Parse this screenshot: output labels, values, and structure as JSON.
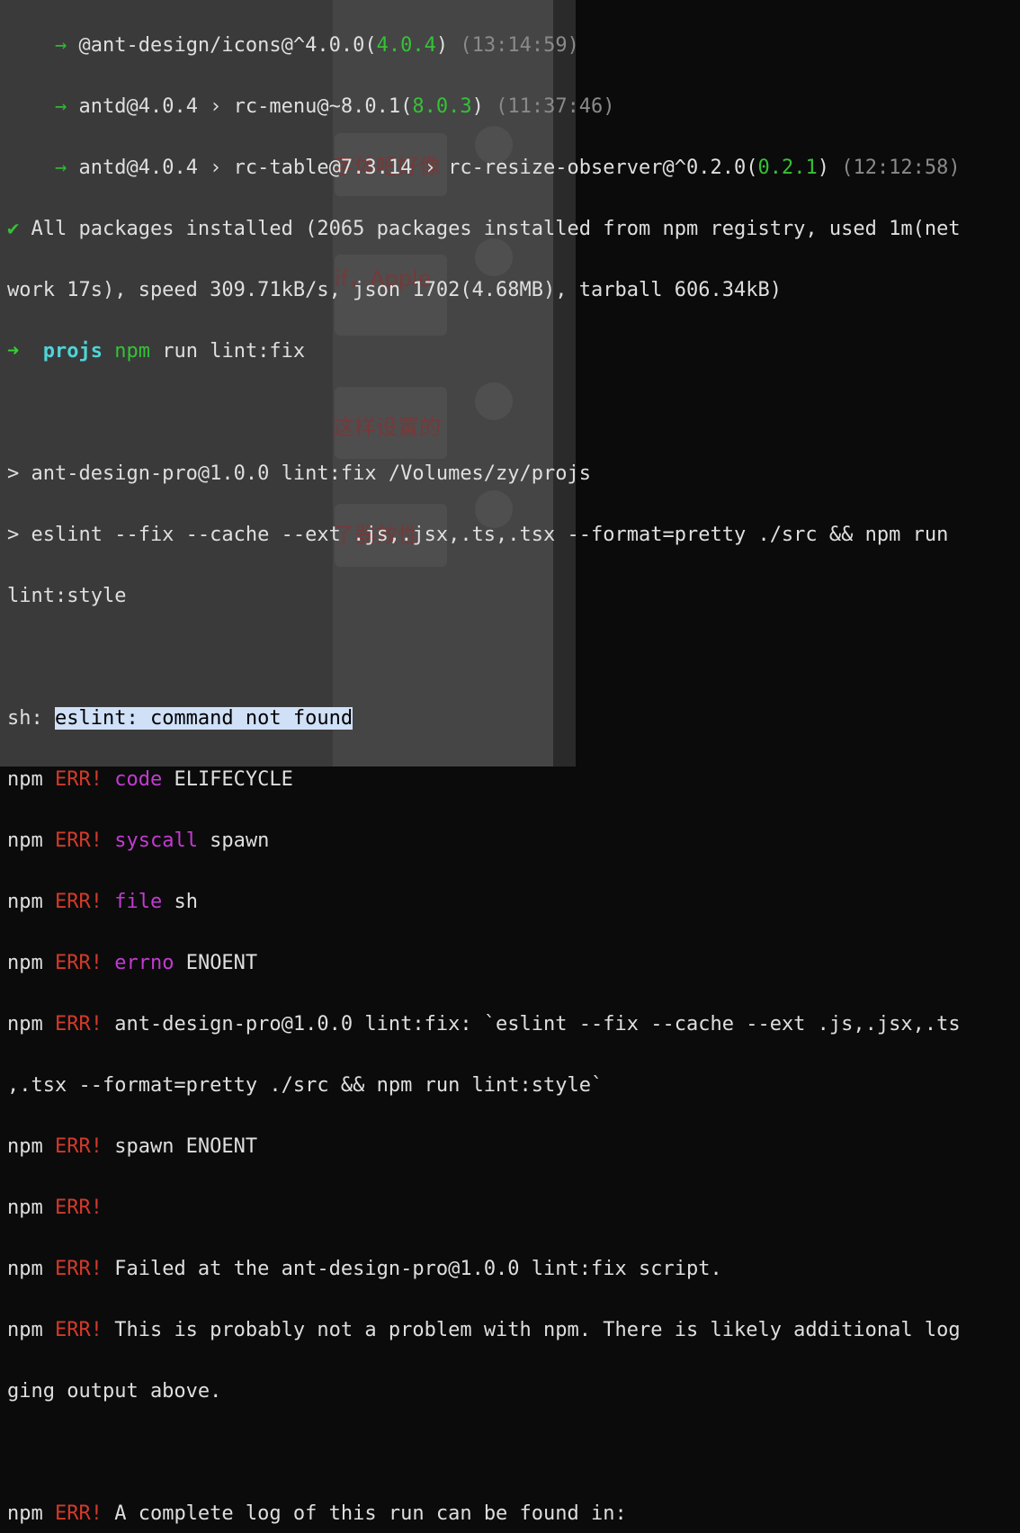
{
  "background_ghost_text": [
    "字体吧好像",
    "if，Apple",
    "这样设置的",
    "了器效性"
  ],
  "lines": {
    "l1": {
      "arrow": "→",
      "a": "@ant-design/icons@^4.0.0(",
      "b": "4.0.4",
      "c": ")",
      "time": "(13:14:59)"
    },
    "l2": {
      "arrow": "→",
      "a": "antd@4.0.4 › rc-menu@~8.0.1(",
      "b": "8.0.3",
      "c": ")",
      "time": "(11:37:46)"
    },
    "l3": {
      "arrow": "→",
      "a": "antd@4.0.4 › rc-table@7.3.14 › rc-resize-observer@^0.2.0(",
      "b": "0.2.1",
      "c": ")",
      "time": "(12:12:58)"
    },
    "l4": {
      "check": "✔",
      "text": " All packages installed (2065 packages installed from npm registry, used 1m(net"
    },
    "l5": "work 17s), speed 309.71kB/s, json 1702(4.68MB), tarball 606.34kB)",
    "l6": {
      "arrow": "➜",
      "dir": "projs",
      "cmd": "npm",
      "rest": " run lint:fix"
    },
    "l8": "> ant-design-pro@1.0.0 lint:fix /Volumes/zy/projs",
    "l9": "> eslint --fix --cache --ext .js,.jsx,.ts,.tsx --format=pretty ./src && npm run",
    "l10": "lint:style",
    "l12": {
      "prefix": "sh: ",
      "selected": "eslint: command not found"
    },
    "npm": "npm ",
    "err": "ERR!",
    "l13": {
      "key": "code",
      "val": " ELIFECYCLE"
    },
    "l14": {
      "key": "syscall",
      "val": " spawn"
    },
    "l15": {
      "key": "file",
      "val": " sh"
    },
    "l16": {
      "key": "errno",
      "val": " ENOENT"
    },
    "l17": " ant-design-pro@1.0.0 lint:fix: `eslint --fix --cache --ext .js,.jsx,.ts",
    "l18": ",.tsx --format=pretty ./src && npm run lint:style`",
    "l19": " spawn ENOENT",
    "l21": " Failed at the ant-design-pro@1.0.0 lint:fix script.",
    "l22": " This is probably not a problem with npm. There is likely additional log",
    "l23": "ging output above.",
    "l25": " A complete log of this run can be found in:"
  }
}
